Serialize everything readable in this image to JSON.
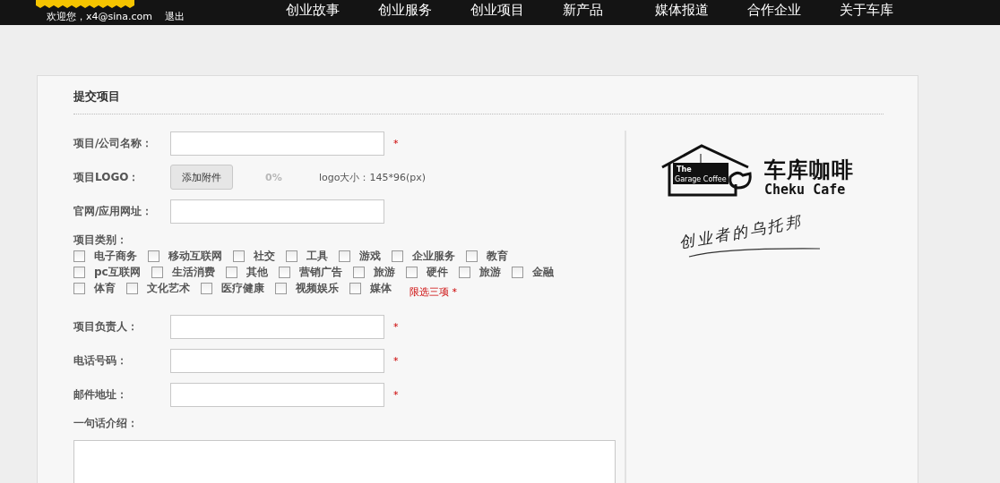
{
  "top_bar": {
    "greeting": "欢迎您，x4@sina.com",
    "logout": "退出",
    "nav": [
      {
        "label": "创业故事"
      },
      {
        "label": "创业服务"
      },
      {
        "label": "创业项目"
      },
      {
        "label": "新产品"
      },
      {
        "label": "媒体报道"
      },
      {
        "label": "合作企业"
      },
      {
        "label": "关于车库"
      }
    ]
  },
  "form": {
    "title": "提交项目",
    "fields": [
      {
        "kind": "text",
        "label": "项目/公司名称：",
        "required": true,
        "required_mark": "*"
      },
      {
        "kind": "upload",
        "label": "项目LOGO：",
        "button": "添加附件",
        "progress": "0%",
        "hint": "logo大小：145*96(px)"
      },
      {
        "kind": "text",
        "label": "官网/应用网址："
      }
    ],
    "category": {
      "label": "项目类别：",
      "rows": [
        [
          {
            "label": "电子商务",
            "checked": false
          },
          {
            "label": "移动互联网",
            "checked": false
          },
          {
            "label": "社交",
            "checked": false
          },
          {
            "label": "工具",
            "checked": false
          },
          {
            "label": "游戏",
            "checked": false
          },
          {
            "label": "企业服务",
            "checked": false
          },
          {
            "label": "教育",
            "checked": false
          }
        ],
        [
          {
            "label": "pc互联网",
            "checked": false
          },
          {
            "label": "生活消费",
            "checked": false
          },
          {
            "label": "其他",
            "checked": false
          },
          {
            "label": "营销广告",
            "checked": false
          },
          {
            "label": "旅游",
            "checked": false
          },
          {
            "label": "硬件",
            "checked": false
          },
          {
            "label": "旅游",
            "checked": false
          },
          {
            "label": "金融",
            "checked": false
          }
        ],
        [
          {
            "label": "体育",
            "checked": false
          },
          {
            "label": "文化艺术",
            "checked": false
          },
          {
            "label": "医疗健康",
            "checked": false
          },
          {
            "label": "视频娱乐",
            "checked": false
          },
          {
            "label": "媒体",
            "checked": false
          }
        ]
      ],
      "limit_note": "限选三项 *"
    },
    "contact_fields": [
      {
        "kind": "text",
        "label": "项目负责人：",
        "required": true,
        "required_mark": "*"
      },
      {
        "kind": "text",
        "label": "电话号码：",
        "required": true,
        "required_mark": "*"
      },
      {
        "kind": "text",
        "label": "邮件地址：",
        "required": true,
        "required_mark": "*"
      }
    ],
    "intro_label": "一句话介绍："
  },
  "brand": {
    "sign_top": "The",
    "sign_bottom": "Garage Coffee",
    "name_cn": "车库咖啡",
    "name_en": "Cheku Cafe",
    "slogan": "创业者的乌托邦"
  }
}
